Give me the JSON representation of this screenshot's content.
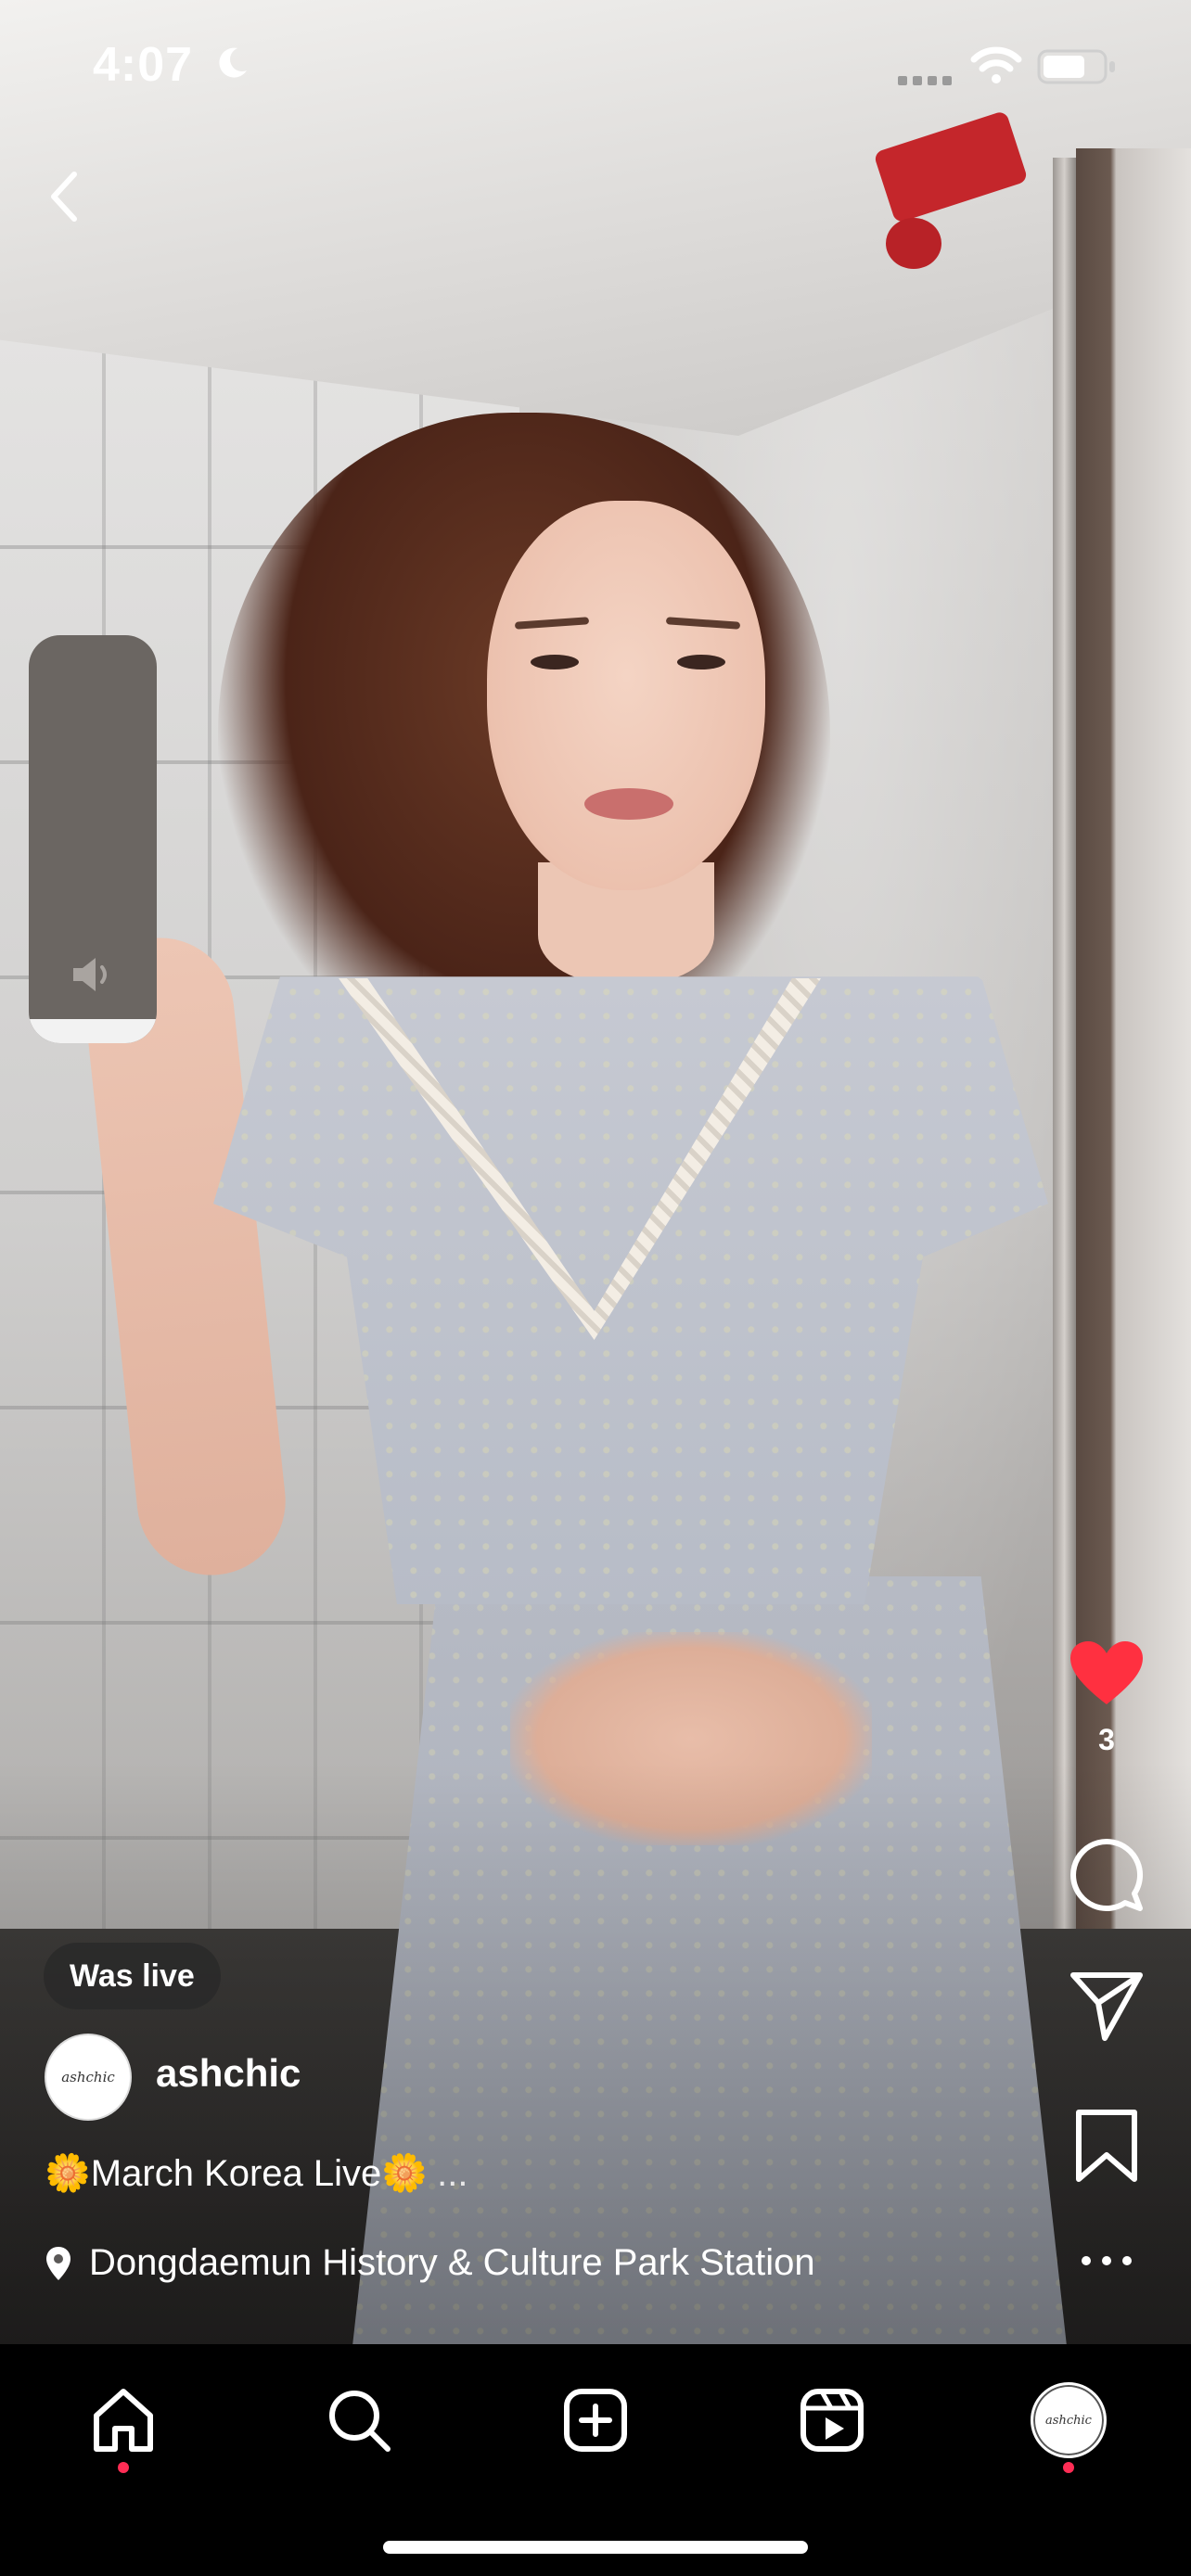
{
  "status_bar": {
    "time": "4:07",
    "focus_icon": "moon-icon",
    "signal_icon": "cellular-signal-icon",
    "wifi_icon": "wifi-icon",
    "battery_icon": "battery-icon"
  },
  "header": {
    "back_icon": "chevron-left-icon"
  },
  "volume": {
    "level": 0.06,
    "icon": "speaker-icon"
  },
  "actions": {
    "like_icon": "heart-filled-icon",
    "like_count": "3",
    "like_color": "#ff3040",
    "comment_icon": "comment-icon",
    "share_icon": "send-icon",
    "save_icon": "bookmark-icon",
    "more_icon": "more-horizontal-icon"
  },
  "post": {
    "badge": "Was live",
    "avatar_text": "ashchic",
    "username": "ashchic",
    "caption": "🌼March Korea Live🌼",
    "caption_more": "...",
    "location": "Dongdaemun History & Culture Park Station"
  },
  "tabbar": {
    "tabs": [
      {
        "icon": "home-icon",
        "has_dot": true
      },
      {
        "icon": "search-icon",
        "has_dot": false
      },
      {
        "icon": "create-icon",
        "has_dot": false
      },
      {
        "icon": "reels-icon",
        "has_dot": false
      },
      {
        "icon": "profile-avatar-icon",
        "has_dot": true,
        "avatar_text": "ashchic"
      }
    ],
    "dot_color": "#ff2d55"
  }
}
